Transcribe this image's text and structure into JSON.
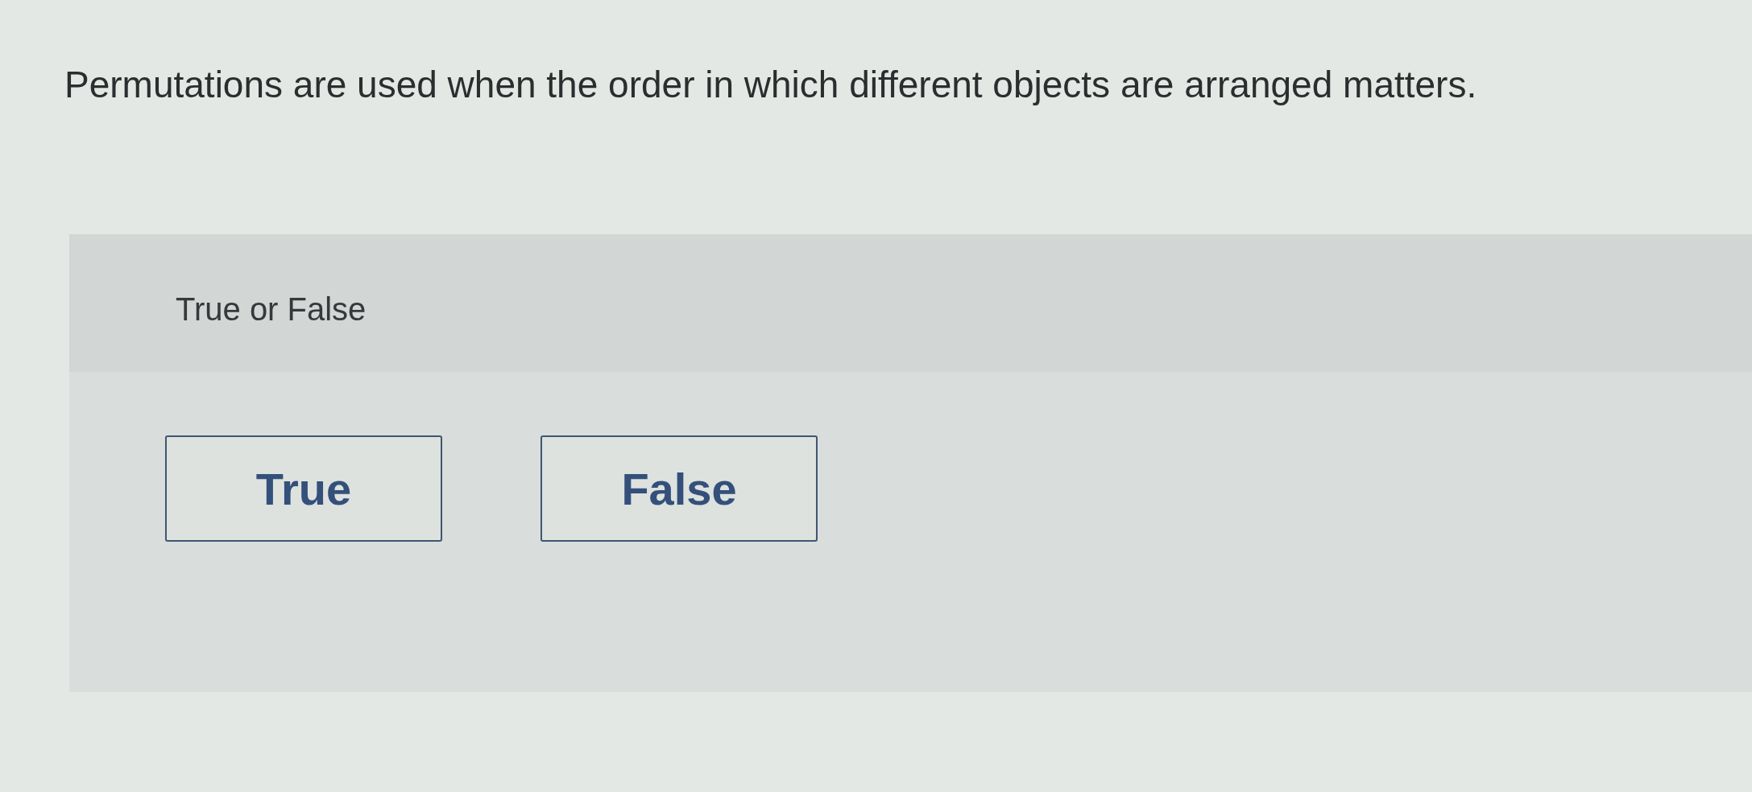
{
  "question": "Permutations are used when the order in which different objects are arranged matters.",
  "prompt": "True or False",
  "options": [
    {
      "label": "True",
      "selected": false
    },
    {
      "label": "False",
      "selected": false
    }
  ]
}
